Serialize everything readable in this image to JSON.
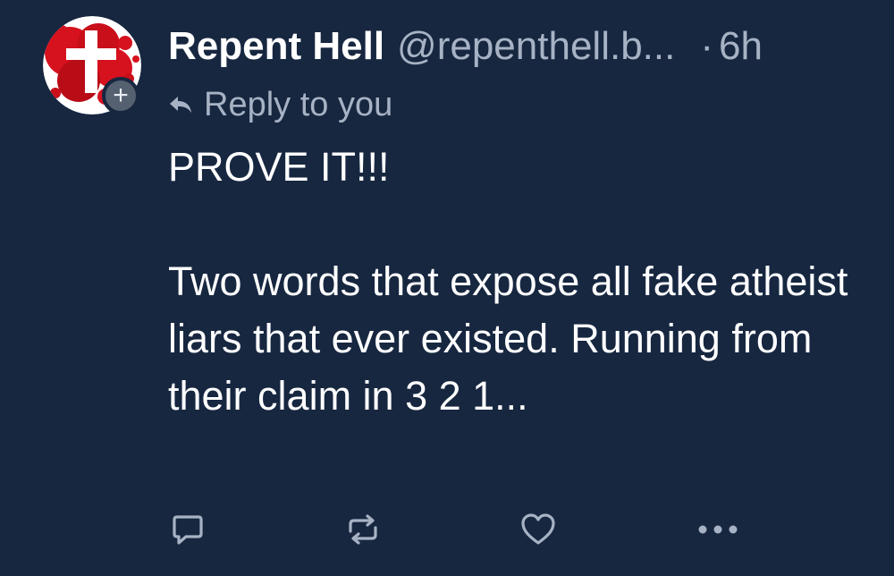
{
  "author": {
    "display_name": "Repent Hell",
    "handle": "@repenthell.b...",
    "time_separator": "·",
    "time": "6h",
    "avatar_icon": "red-splatter-cross-avatar",
    "follow_badge": "+"
  },
  "reply_context": {
    "icon": "reply-arrow-icon",
    "label": "Reply to you"
  },
  "post": {
    "line1": "PROVE IT!!!",
    "paragraph2": "Two words that expose all fake atheist liars that ever existed. Running from their claim in 3 2 1..."
  },
  "actions": {
    "reply_icon": "comment-icon",
    "repost_icon": "repost-icon",
    "like_icon": "heart-icon",
    "more_icon": "more-icon"
  },
  "colors": {
    "background": "#172740",
    "text": "#ffffff",
    "muted": "#a7b3c4",
    "avatar_red": "#d6121e"
  }
}
